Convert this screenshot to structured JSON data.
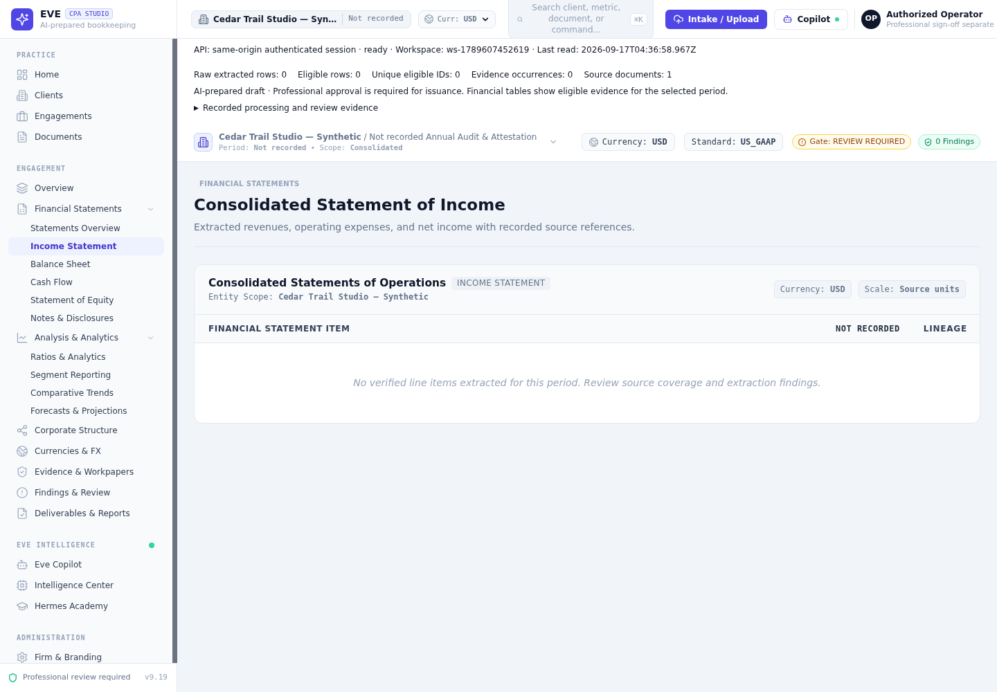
{
  "brand": {
    "name": "EVE",
    "badge": "CPA STUDIO",
    "tagline": "AI-prepared bookkeeping"
  },
  "topbar": {
    "client": {
      "name": "Cedar Trail Studio — Syn…",
      "period": "Not recorded"
    },
    "currency": "Curr: **USD**",
    "search": {
      "placeholder": "Search client, metric, document, or command...",
      "shortcut": "⌘K"
    },
    "upload_button": {
      "label": "Intake / Upload"
    },
    "copilot_button": {
      "label": "Copilot",
      "online": true
    },
    "user": {
      "initials": "OP",
      "name": "Authorized Operator",
      "note": "Professional sign-off separate"
    }
  },
  "sidebar": {
    "sections": [
      {
        "title": "PRACTICE",
        "items": [
          {
            "label": "Home",
            "selected": false
          },
          {
            "label": "Clients",
            "selected": false
          },
          {
            "label": "Engagements",
            "selected": false
          },
          {
            "label": "Documents",
            "selected": false
          }
        ]
      },
      {
        "title": "ENGAGEMENT",
        "items": [
          {
            "label": "Overview",
            "selected": false
          },
          {
            "label": "Financial Statements",
            "selected": false,
            "expanded": true,
            "children": [
              {
                "label": "Statements Overview",
                "selected": false
              },
              {
                "label": "Income Statement",
                "selected": true
              },
              {
                "label": "Balance Sheet",
                "selected": false
              },
              {
                "label": "Cash Flow",
                "selected": false
              },
              {
                "label": "Statement of Equity",
                "selected": false
              },
              {
                "label": "Notes & Disclosures",
                "selected": false
              }
            ]
          },
          {
            "label": "Analysis & Analytics",
            "selected": false,
            "expanded": true,
            "children": [
              {
                "label": "Ratios & Analytics",
                "selected": false
              },
              {
                "label": "Segment Reporting",
                "selected": false
              },
              {
                "label": "Comparative Trends",
                "selected": false
              },
              {
                "label": "Forecasts & Projections",
                "selected": false
              }
            ]
          },
          {
            "label": "Corporate Structure",
            "selected": false
          },
          {
            "label": "Currencies & FX",
            "selected": false
          },
          {
            "label": "Evidence & Workpapers",
            "selected": false
          },
          {
            "label": "Findings & Review",
            "selected": false
          },
          {
            "label": "Deliverables & Reports",
            "selected": false
          }
        ]
      },
      {
        "title": "EVE INTELLIGENCE",
        "live": true,
        "items": [
          {
            "label": "Eve Copilot",
            "selected": false
          },
          {
            "label": "Intelligence Center",
            "selected": false
          },
          {
            "label": "Hermes Academy",
            "selected": false
          }
        ]
      },
      {
        "title": "ADMINISTRATION",
        "items": [
          {
            "label": "Firm & Branding",
            "selected": false
          }
        ]
      }
    ],
    "footer": {
      "note": "Professional review required",
      "version": "v9.19"
    }
  },
  "status": {
    "api_line": "API: same-origin authenticated session · ready · Workspace: ws-1789607452619 · Last read: 2026-09-17T04:36:58.967Z",
    "stats": [
      "Raw extracted rows: 0",
      "Eligible rows: 0",
      "Unique eligible IDs: 0",
      "Evidence occurrences: 0",
      "Source documents: 1"
    ],
    "notice": "AI-prepared draft · Professional approval is required for issuance. Financial tables show eligible evidence for the selected period.",
    "evidence_toggle": {
      "label": "Recorded processing and review evidence",
      "expanded": false
    }
  },
  "context": {
    "title": "**Cedar Trail Studio — Synthetic** / Not recorded Annual Audit & Attestation",
    "meta": "Period: **Not recorded** • Scope: **Consolidated**",
    "chips": [
      {
        "kind": "currency",
        "label": "Currency: **USD**"
      },
      {
        "kind": "standard",
        "label": "Standard: **US_GAAP**"
      },
      {
        "kind": "gate",
        "label": "Gate: REVIEW REQUIRED"
      },
      {
        "kind": "findings",
        "label": "0 Findings"
      }
    ]
  },
  "page": {
    "eyebrow": "FINANCIAL STATEMENTS",
    "title": "Consolidated Statement of Income",
    "subtitle": "Extracted revenues, operating expenses, and net income with recorded source references."
  },
  "statement": {
    "title": "Consolidated Statements of Operations",
    "badge": "INCOME STATEMENT",
    "entity": "Entity Scope: **Cedar Trail Studio — Synthetic**",
    "chips": [
      "Currency: **USD**",
      "Scale: **Source units**"
    ],
    "table": {
      "columns": [
        {
          "kind": "item",
          "label": "FINANCIAL STATEMENT ITEM"
        },
        {
          "kind": "period",
          "label": "NOT RECORDED"
        },
        {
          "kind": "lineage",
          "label": "LINEAGE"
        }
      ],
      "empty_message": "No verified line items extracted for this period. Review source coverage and extraction findings."
    }
  }
}
